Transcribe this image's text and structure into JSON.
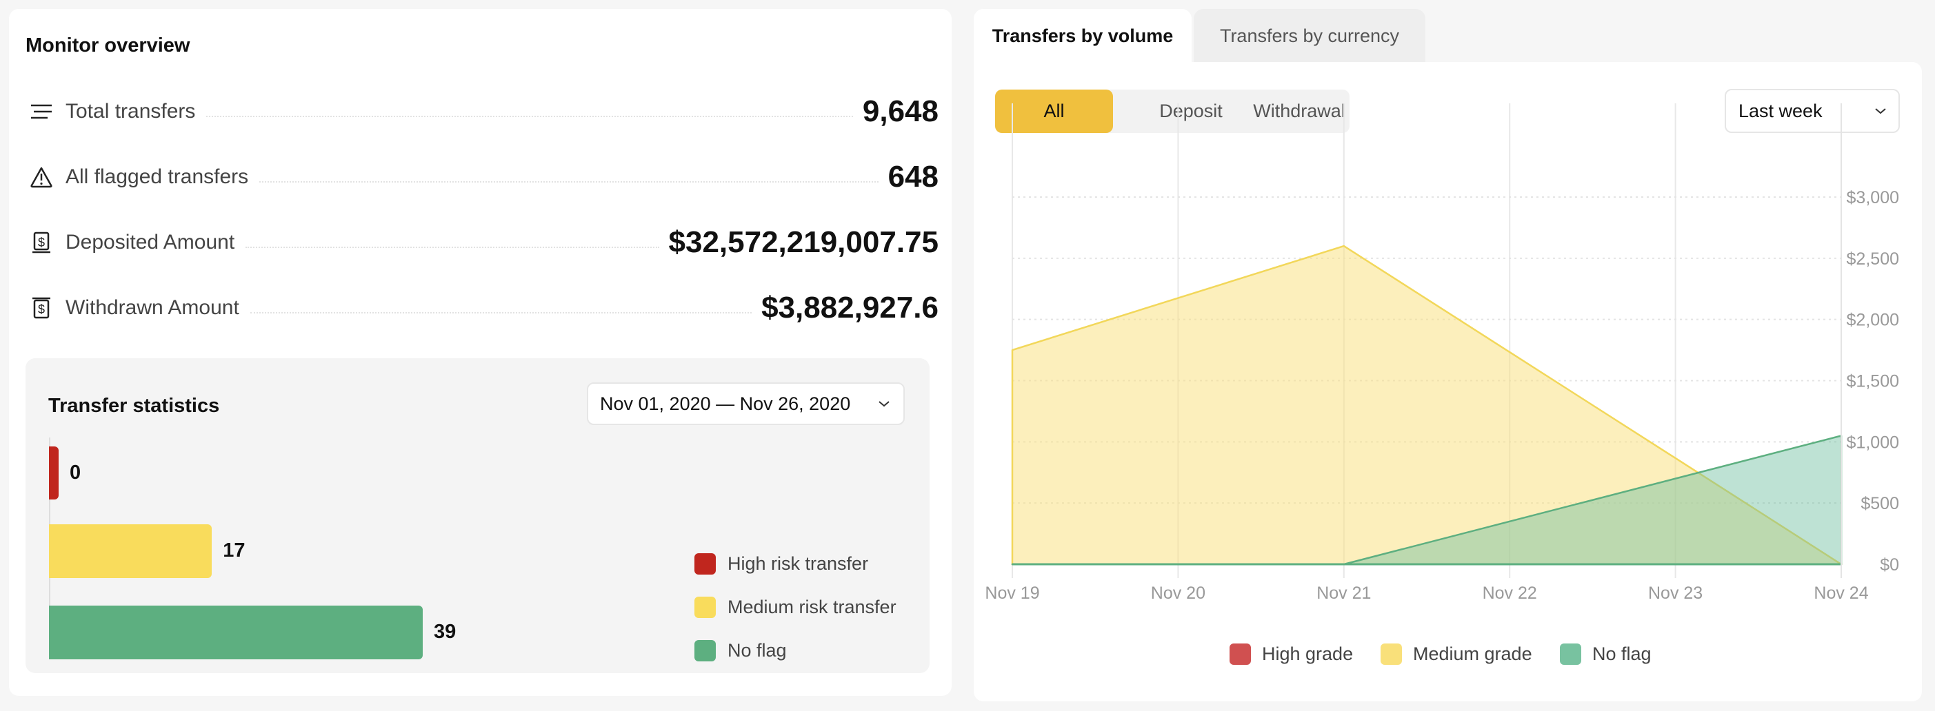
{
  "monitor": {
    "title": "Monitor overview",
    "metrics": [
      {
        "icon": "list-icon",
        "label": "Total transfers",
        "value": "9,648"
      },
      {
        "icon": "warning-icon",
        "label": "All flagged transfers",
        "value": "648"
      },
      {
        "icon": "deposit-icon",
        "label": "Deposited Amount",
        "value": "$32,572,219,007.75"
      },
      {
        "icon": "withdraw-icon",
        "label": "Withdrawn Amount",
        "value": "$3,882,927.6"
      }
    ]
  },
  "transfer_statistics": {
    "title": "Transfer statistics",
    "date_range": "Nov 01, 2020 — Nov 26, 2020",
    "bars": [
      {
        "label": "High risk transfer",
        "value": 0,
        "display": "0",
        "color": "#c0261e"
      },
      {
        "label": "Medium risk transfer",
        "value": 17,
        "display": "17",
        "color": "#f9dc5c"
      },
      {
        "label": "No flag",
        "value": 39,
        "display": "39",
        "color": "#5daf80"
      }
    ]
  },
  "volume_panel": {
    "tabs": [
      {
        "label": "Transfers by volume",
        "active": true
      },
      {
        "label": "Transfers by currency",
        "active": false
      }
    ],
    "filters": [
      {
        "label": "All",
        "active": true
      },
      {
        "label": "Deposit",
        "active": false
      },
      {
        "label": "Withdrawal",
        "active": false
      }
    ],
    "period": "Last week",
    "accent_color": "#f0c03e"
  },
  "chart_data": {
    "type": "area",
    "title": "",
    "xlabel": "",
    "ylabel": "",
    "x": [
      "Nov 19",
      "Nov 20",
      "Nov 21",
      "Nov 22",
      "Nov 23",
      "Nov 24"
    ],
    "ylim": [
      0,
      3000
    ],
    "yticks": [
      0,
      500,
      1000,
      1500,
      2000,
      2500,
      3000
    ],
    "ytick_labels": [
      "$0",
      "$500",
      "$1,000",
      "$1,500",
      "$2,000",
      "$2,500",
      "$3,000"
    ],
    "y_axis_position": "right",
    "grid": true,
    "legend_position": "bottom",
    "series": [
      {
        "name": "High grade",
        "color": "#d05050",
        "values": [
          0,
          0,
          0,
          0,
          0,
          0
        ]
      },
      {
        "name": "Medium grade",
        "color": "#f9e07a",
        "values": [
          1750,
          2175,
          2600,
          1733,
          867,
          0
        ]
      },
      {
        "name": "No flag",
        "color": "#78c2a0",
        "values": [
          0,
          0,
          0,
          350,
          700,
          1050
        ]
      }
    ]
  }
}
